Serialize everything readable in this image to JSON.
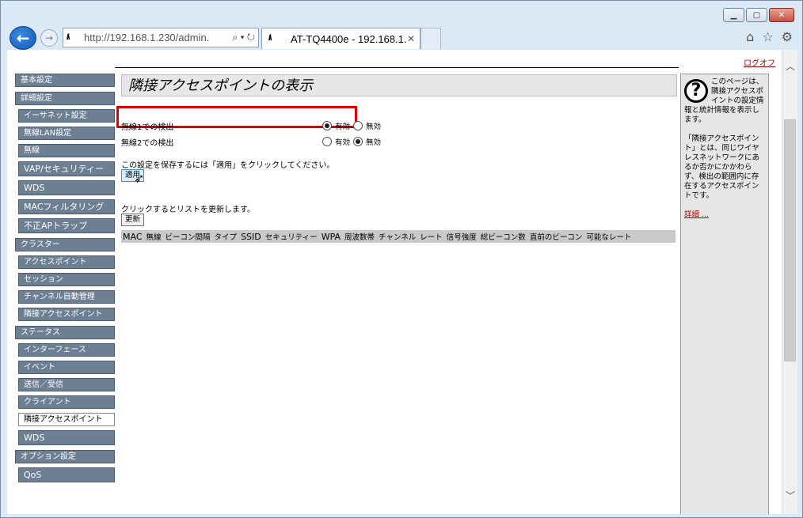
{
  "browser": {
    "url": "http://192.168.1.230/admin.",
    "addr_logo": "//\\",
    "tab_title": "AT-TQ4400e - 192.168.1...",
    "tab_logo": "//\\"
  },
  "page": {
    "logout": "ログオフ",
    "title": "隣接アクセスポイントの表示",
    "radio1_label": "無線1での検出",
    "radio2_label": "無線2での検出",
    "enabled": "有効",
    "disabled": "無効",
    "save_note": "この設定を保存するには「適用」をクリックしてください。",
    "apply_label": "適用",
    "refresh_note": "クリックするとリストを更新します。",
    "refresh_label": "更新",
    "columns": [
      "MAC",
      "無線",
      "ビーコン間隔",
      "タイプ",
      "SSID",
      "セキュリティー",
      "WPA",
      "周波数帯",
      "チャンネル",
      "レート",
      "信号強度",
      "総ビーコン数",
      "直前のビーコン",
      "可能なレート"
    ]
  },
  "sidebar": {
    "items": [
      {
        "label": "基本設定"
      },
      {
        "label": "詳細設定"
      },
      {
        "label": "イーサネット設定"
      },
      {
        "label": "無線LAN設定"
      },
      {
        "label": "無線"
      },
      {
        "label": "VAP/セキュリティー"
      },
      {
        "label": "WDS"
      },
      {
        "label": "MACフィルタリング"
      },
      {
        "label": "不正APトラップ"
      },
      {
        "label": "クラスター"
      },
      {
        "label": "アクセスポイント"
      },
      {
        "label": "セッション"
      },
      {
        "label": "チャンネル自動管理"
      },
      {
        "label": "隣接アクセスポイント"
      },
      {
        "label": "ステータス"
      },
      {
        "label": "インターフェース"
      },
      {
        "label": "イベント"
      },
      {
        "label": "送信／受信"
      },
      {
        "label": "クライアント"
      },
      {
        "label": "隣接アクセスポイント"
      },
      {
        "label": "WDS"
      },
      {
        "label": "オプション設定"
      },
      {
        "label": "QoS"
      }
    ]
  },
  "help": {
    "icon_glyph": "?",
    "p1": "このページは、隣接アクセスポイントの設定情報と統計情報を表示します。",
    "p2": "「隣接アクセスポイント」とは、同じワイヤレスネットワークにあるか否かにかかわらず、検出の範囲内に存在するアクセスポイントです。",
    "more": "詳細 ..."
  }
}
